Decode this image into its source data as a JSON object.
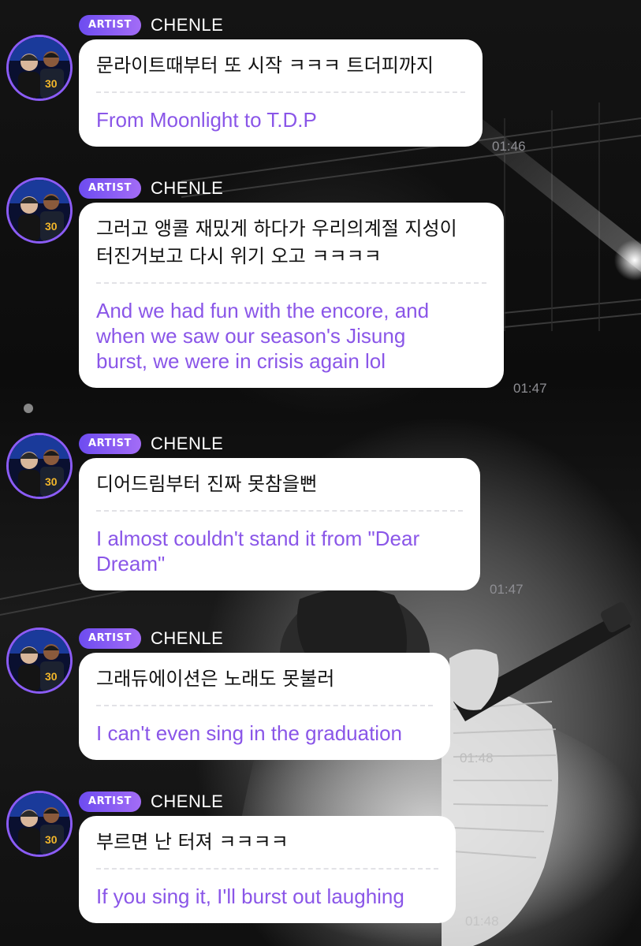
{
  "colors": {
    "accent": "#8a56e8",
    "badge_start": "#6d4cf0",
    "badge_end": "#a36cf6",
    "bubble": "#ffffff",
    "timestamp": "#8e8e93"
  },
  "messages": [
    {
      "badge": "ARTIST",
      "sender": "CHENLE",
      "original": "문라이트때부터 또 시작 ㅋㅋㅋ 트더피까지",
      "translation": "From Moonlight to T.D.P",
      "time": "01:46"
    },
    {
      "badge": "ARTIST",
      "sender": "CHENLE",
      "original": "그러고 앵콜 재밌게 하다가 우리의계절 지성이\n터진거보고 다시 위기 오고 ㅋㅋㅋㅋ",
      "translation": "And we had fun with the encore, and\nwhen we saw our season's Jisung\nburst, we were in crisis again lol",
      "time": "01:47"
    },
    {
      "badge": "ARTIST",
      "sender": "CHENLE",
      "original": "디어드림부터 진짜 못참을뻔",
      "translation": "I almost couldn't stand it from \"Dear\nDream\"",
      "time": "01:47"
    },
    {
      "badge": "ARTIST",
      "sender": "CHENLE",
      "original": "그래듀에이션은 노래도 못불러",
      "translation": "I can't even sing in the graduation",
      "time": "01:48"
    },
    {
      "badge": "ARTIST",
      "sender": "CHENLE",
      "original": "부르면 난 터져 ㅋㅋㅋㅋ",
      "translation": "If you sing it, I'll burst out laughing",
      "time": "01:48"
    }
  ]
}
